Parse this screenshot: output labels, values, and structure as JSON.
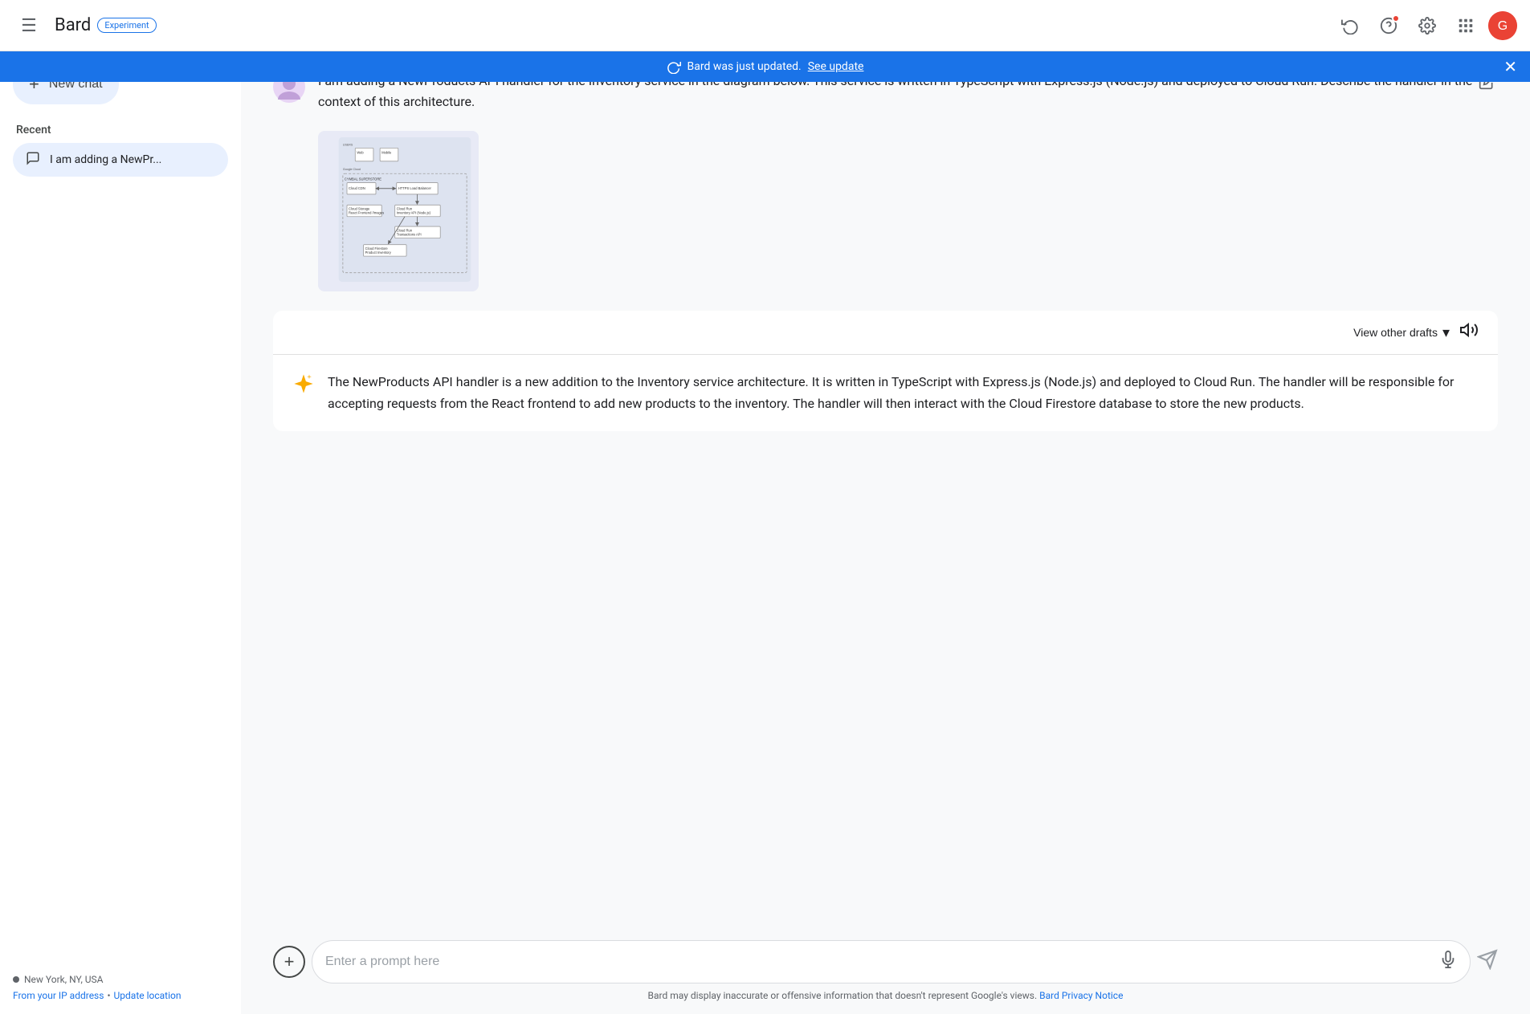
{
  "header": {
    "menu_icon": "☰",
    "logo_text": "Bard",
    "badge_text": "Experiment",
    "icons": {
      "history": "🕐",
      "help": "?",
      "settings": "⚙",
      "apps": "⠿"
    }
  },
  "banner": {
    "message": "Bard was just updated.",
    "link_text": "See update",
    "close_icon": "✕"
  },
  "sidebar": {
    "new_chat_label": "New chat",
    "recent_label": "Recent",
    "recent_items": [
      {
        "label": "I am adding a NewPr..."
      }
    ],
    "footer": {
      "location": "New York, NY, USA",
      "from_ip_text": "From your IP address",
      "separator": "•",
      "update_location": "Update location"
    }
  },
  "user_message": {
    "text": "I am adding a NewProducts API handler for the Inventory service in the diagram below. This service is written in TypeScript with Express.js (Node.js) and deployed to Cloud Run. Describe the handler in the context of this architecture.",
    "edit_icon": "✏"
  },
  "drafts_bar": {
    "label": "View other drafts",
    "chevron": "▾",
    "volume_icon": "🔊"
  },
  "bard_response": {
    "star_icon": "✦",
    "text": "The NewProducts API handler is a new addition to the Inventory service architecture. It is written in TypeScript with Express.js (Node.js) and deployed to Cloud Run. The handler will be responsible for accepting requests from the React frontend to add new products to the inventory. The handler will then interact with the Cloud Firestore database to store the new products."
  },
  "input": {
    "placeholder": "Enter a prompt here",
    "add_icon": "+",
    "mic_icon": "🎤",
    "send_icon": "➤"
  },
  "disclaimer": {
    "text": "Bard may display inaccurate or offensive information that doesn't represent Google's views.",
    "link_text": "Bard Privacy Notice"
  },
  "colors": {
    "primary_blue": "#1a73e8",
    "bard_star": "#f9ab00",
    "header_bg": "#ffffff",
    "banner_bg": "#1a73e8",
    "accent_red": "#ea4335"
  }
}
